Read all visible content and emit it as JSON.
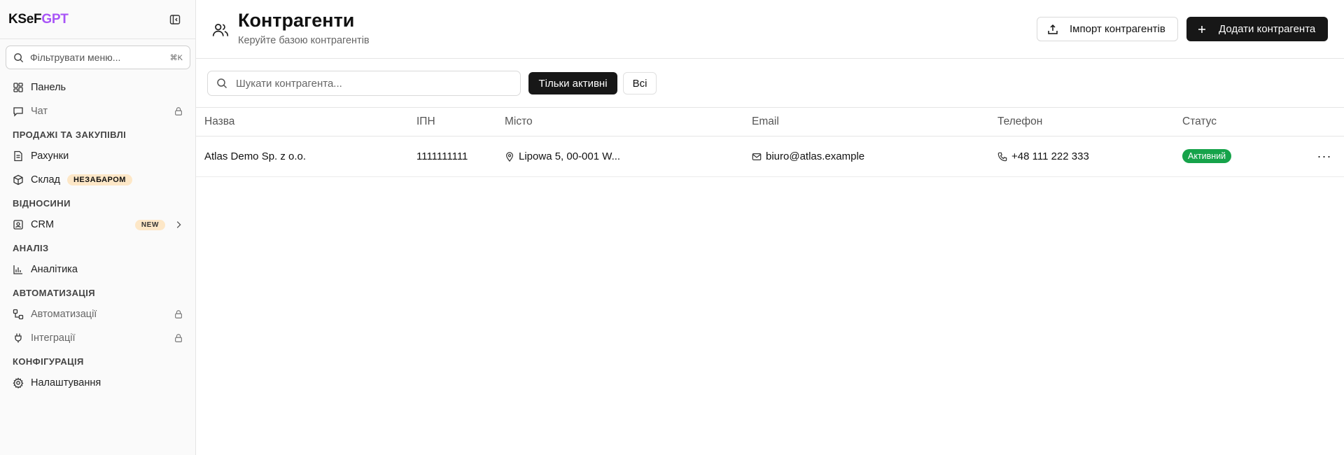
{
  "sidebar": {
    "logo_a": "KSeF",
    "logo_b": "GPT",
    "filter_placeholder": "Фільтрувати меню...",
    "filter_shortcut": "⌘K",
    "items": {
      "panel": "Панель",
      "chat": "Чат",
      "sec_sales": "ПРОДАЖІ ТА ЗАКУПІВЛІ",
      "invoices": "Рахунки",
      "warehouse": "Склад",
      "warehouse_badge": "НЕЗАБАРОМ",
      "sec_relations": "ВІДНОСИНИ",
      "crm": "CRM",
      "crm_badge": "NEW",
      "sec_analysis": "АНАЛІЗ",
      "analytics": "Аналітика",
      "sec_automation": "АВТОМАТИЗАЦІЯ",
      "automations": "Автоматизації",
      "integrations": "Інтеграції",
      "sec_config": "КОНФІГУРАЦІЯ",
      "settings": "Налаштування"
    }
  },
  "header": {
    "title": "Контрагенти",
    "subtitle": "Керуйте базою контрагентів",
    "import_label": "Імпорт контрагентів",
    "add_label": "Додати контрагента"
  },
  "toolbar": {
    "search_placeholder": "Шукати контрагента...",
    "filter_active": "Тільки активні",
    "filter_all": "Всі"
  },
  "table": {
    "columns": {
      "name": "Назва",
      "tax_id": "ІПН",
      "city": "Місто",
      "email": "Email",
      "phone": "Телефон",
      "status": "Статус"
    },
    "rows": [
      {
        "name": "Atlas Demo Sp. z o.o.",
        "tax_id": "1111111111",
        "city": "Lipowa 5, 00-001 W...",
        "email": "biuro@atlas.example",
        "phone": "+48 111 222 333",
        "status": "Активний",
        "actions": "···"
      }
    ]
  },
  "colors": {
    "accent": "#a855f7",
    "primary_button": "#171717",
    "status_active": "#16a34a",
    "badge_bg": "#fde7c7"
  }
}
